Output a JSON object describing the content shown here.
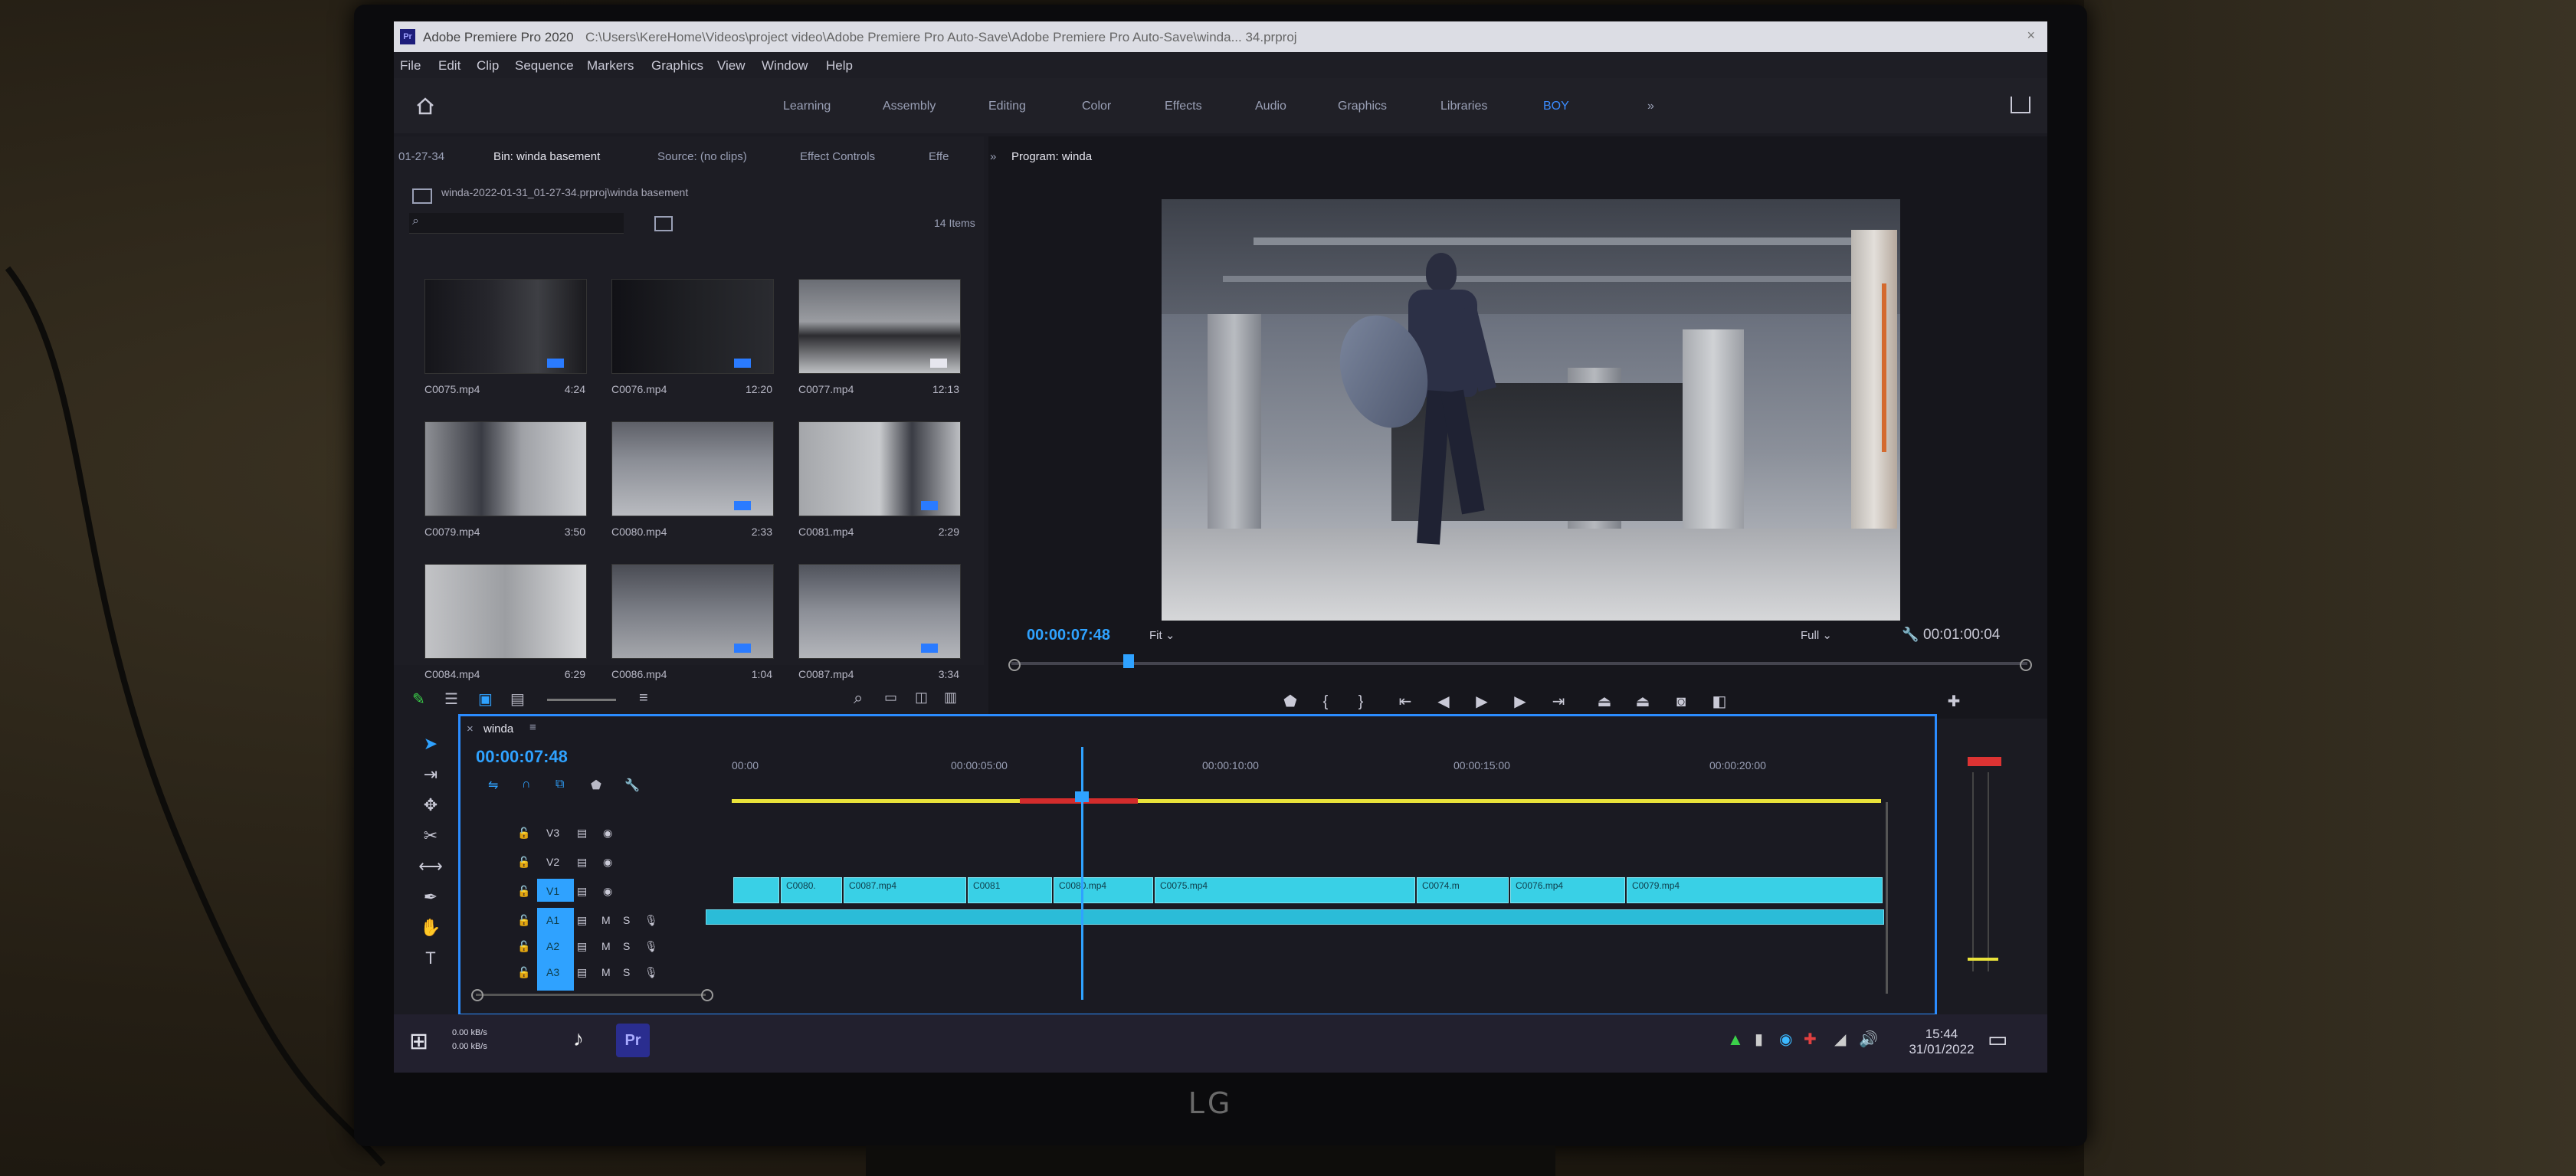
{
  "titlebar": {
    "app_title": "Adobe Premiere Pro 2020",
    "path": "C:\\Users\\KereHome\\Videos\\project video\\Adobe Premiere Pro Auto-Save\\Adobe Premiere Pro Auto-Save\\winda... 34.prproj"
  },
  "menu": [
    "File",
    "Edit",
    "Clip",
    "Sequence",
    "Markers",
    "Graphics",
    "View",
    "Window",
    "Help"
  ],
  "workspaces": [
    {
      "label": "Learning",
      "active": false
    },
    {
      "label": "Assembly",
      "active": false
    },
    {
      "label": "Editing",
      "active": false
    },
    {
      "label": "Color",
      "active": false
    },
    {
      "label": "Effects",
      "active": false
    },
    {
      "label": "Audio",
      "active": false
    },
    {
      "label": "Graphics",
      "active": false
    },
    {
      "label": "Libraries",
      "active": false
    },
    {
      "label": "BOY",
      "active": true
    }
  ],
  "workspace_more": "»",
  "project_panel": {
    "tabs": [
      {
        "label": "01-27-34",
        "active": false
      },
      {
        "label": "Bin: winda basement",
        "active": true
      },
      {
        "label": "Source: (no clips)",
        "active": false
      },
      {
        "label": "Effect Controls",
        "active": false
      },
      {
        "label": "Effe",
        "active": false
      }
    ],
    "path": "winda-2022-01-31_01-27-34.prproj\\winda basement",
    "item_count": "14 Items",
    "clips": [
      {
        "name": "C0075.mp4",
        "duration": "4:24"
      },
      {
        "name": "C0076.mp4",
        "duration": "12:20"
      },
      {
        "name": "C0077.mp4",
        "duration": "12:13"
      },
      {
        "name": "C0079.mp4",
        "duration": "3:50"
      },
      {
        "name": "C0080.mp4",
        "duration": "2:33"
      },
      {
        "name": "C0081.mp4",
        "duration": "2:29"
      },
      {
        "name": "C0084.mp4",
        "duration": "6:29"
      },
      {
        "name": "C0086.mp4",
        "duration": "1:04"
      },
      {
        "name": "C0087.mp4",
        "duration": "3:34"
      }
    ]
  },
  "program_monitor": {
    "tab": "Program: winda",
    "current_time": "00:00:07:48",
    "fit": "Fit",
    "resolution": "Full",
    "duration": "00:01:00:04",
    "playhead_fraction": 0.12
  },
  "timeline": {
    "sequence": "winda",
    "timecode": "00:00:07:48",
    "ruler": [
      "00:00",
      "00:00:05:00",
      "00:00:10:00",
      "00:00:15:00",
      "00:00:20:00"
    ],
    "video_tracks": [
      "V3",
      "V2",
      "V1"
    ],
    "audio_tracks": [
      "A1",
      "A2",
      "A3"
    ],
    "clip_labels": [
      "C0080.",
      "C0087.mp4",
      "C0081",
      "C0080.mp4",
      "C0075.mp4",
      "C0074.m",
      "C0076.mp4",
      "C0079.mp4"
    ]
  },
  "taskbar": {
    "net_up": "0.00 kB/s",
    "net_down": "0.00 kB/s",
    "time": "15:44",
    "date": "31/01/2022"
  },
  "monitor_brand": "LG"
}
